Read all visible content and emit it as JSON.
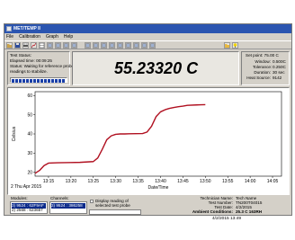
{
  "window": {
    "title": "MET/TEMP II"
  },
  "menu": [
    "File",
    "Calibration",
    "Graph",
    "Help"
  ],
  "toolbar": {
    "icons": [
      "open-file-icon",
      "save-icon",
      "print-icon",
      "chart-icon",
      "table-icon",
      "calibrate-icon",
      "setup-icon",
      "thermometer-icon",
      "probe-icon",
      "report-icon",
      "export-icon",
      "graph-icon",
      "zoom-icon",
      "settings-icon",
      "keyboard-icon",
      "monitor-icon",
      "timer-icon",
      "stop-icon",
      "folder-icon",
      "help-icon"
    ],
    "accent": "#f2d400"
  },
  "test_status": {
    "heading": "Test Status:",
    "elapsed": "Elapsed time: 00:09:25",
    "status_line1": "Status: Waiting for reference probe",
    "status_line2": "readings to stabilize."
  },
  "reading": {
    "value": "55.23320 C"
  },
  "setpoint": {
    "title": "Set point: 75.00 C",
    "window_label": "Window:",
    "window_value": "0.500C",
    "tolerance_label": "Tolerance:",
    "tolerance_value": "0.250C",
    "duration_label": "Duration:",
    "duration_value": "30 sec",
    "heat_label": "Heat Source:",
    "heat_value": "9142"
  },
  "chart_data": {
    "type": "line",
    "ylabel": "Celsius",
    "xlabel": "Date/Time",
    "date_label": "2 Thu Apr 2015",
    "yticks": [
      "20",
      "30",
      "40",
      "50",
      "60"
    ],
    "ylim": [
      18,
      62
    ],
    "xticks": [
      "13:15",
      "13:20",
      "13:25",
      "13:30",
      "13:35",
      "13:40",
      "13:45",
      "13:50",
      "13:55",
      "14:00",
      "14:05"
    ],
    "x": [
      "13:12",
      "13:13",
      "13:14",
      "13:15",
      "13:17",
      "13:20",
      "13:22",
      "13:25",
      "13:26",
      "13:27",
      "13:28",
      "13:29",
      "13:30",
      "13:31",
      "13:32",
      "13:33",
      "13:36",
      "13:37",
      "13:38",
      "13:39",
      "13:40",
      "13:41",
      "13:42",
      "13:43",
      "13:44",
      "13:45",
      "13:46",
      "13:48",
      "13:49",
      "13:50"
    ],
    "y": [
      19.5,
      21,
      23.5,
      24.8,
      25.0,
      25.1,
      25.2,
      25.6,
      27.5,
      32,
      37,
      39,
      39.8,
      40,
      40,
      40.1,
      40.2,
      41,
      44,
      49,
      51.5,
      52.6,
      53.3,
      53.8,
      54.2,
      54.5,
      54.9,
      55.1,
      55.2,
      55.23
    ],
    "series_color": "#b01020",
    "grid": false
  },
  "modules": {
    "label": "Modules:",
    "items": [
      "3) 9524 : 62F9AF",
      "2) 2568 : 623657"
    ]
  },
  "channels": {
    "label": "Channels:",
    "items": [
      "3) 9524 : 386258"
    ]
  },
  "display_option": {
    "label_line1": "Display reading of",
    "label_line2": "selected test probe"
  },
  "test_info": {
    "tech_label": "Technician Name:",
    "tech_value": "Tech Name",
    "testnum_label": "Test Number:",
    "testnum_value": "TN200T04015",
    "date_label": "Test Date:",
    "date_value": "4/2/2015",
    "ambient_label": "Ambient Conditions:",
    "ambient_value": "25.3 C   163RH",
    "footer": "4/2/2015   13:49"
  }
}
